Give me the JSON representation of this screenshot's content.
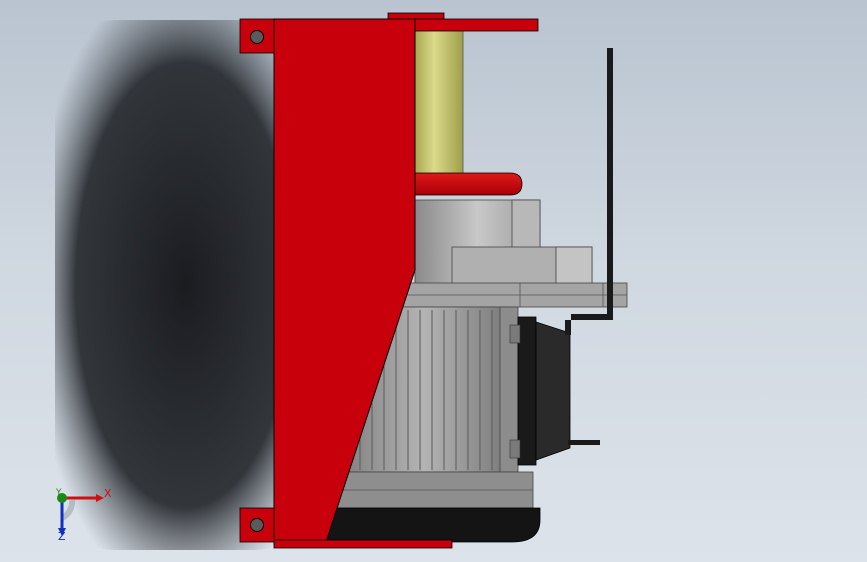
{
  "viewport": {
    "background_top": "#b9c4d0",
    "background_bottom": "#dde3ea"
  },
  "model": {
    "frame_color": "#c8000c",
    "drum_color": "#c8c870",
    "motor_color": "#9a9a9a",
    "rail_color": "#1a1a1a"
  },
  "triad": {
    "x_label": "X",
    "y_label": "Y",
    "z_label": "Z",
    "x_color": "#d01010",
    "y_color": "#1a8a1a",
    "z_color": "#1030c0"
  }
}
